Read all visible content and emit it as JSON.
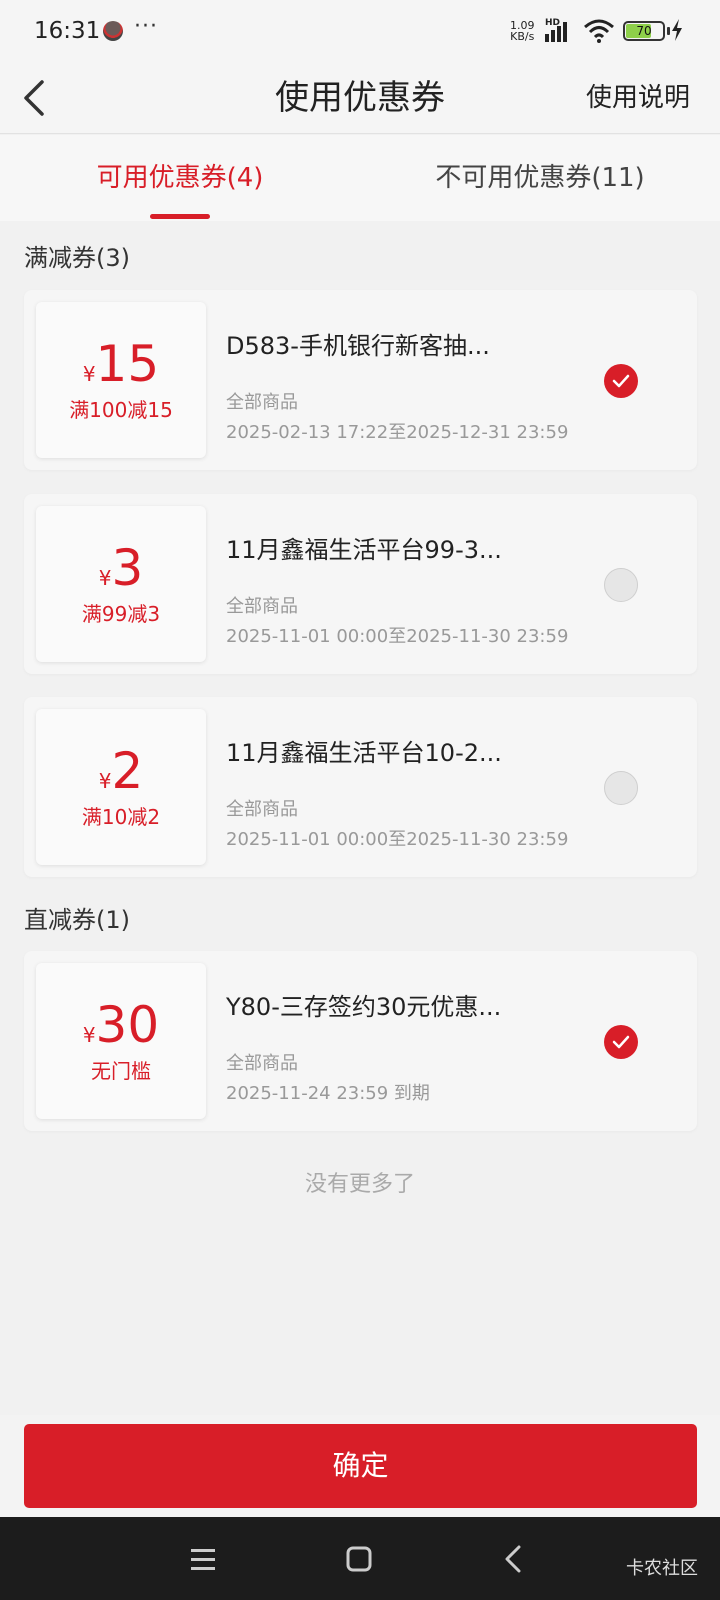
{
  "status_bar": {
    "time": "16:31",
    "more": "···",
    "net_speed_value": "1.09",
    "net_speed_unit": "KB/s",
    "network_badge": "HD",
    "battery": "70"
  },
  "nav": {
    "title": "使用优惠券",
    "help": "使用说明"
  },
  "tabs": [
    {
      "label": "可用优惠券(4)",
      "active": true
    },
    {
      "label": "不可用优惠券(11)",
      "active": false
    }
  ],
  "sections": [
    {
      "title": "满减券(3)"
    },
    {
      "title": "直减券(1)"
    }
  ],
  "coupons": [
    {
      "currency": "¥",
      "amount": "15",
      "condition": "满100减15",
      "name": "D583-手机银行新客抽...",
      "scope": "全部商品",
      "validity": "2025-02-13 17:22至2025-12-31 23:59",
      "selected": true
    },
    {
      "currency": "¥",
      "amount": "3",
      "condition": "满99减3",
      "name": "11月鑫福生活平台99-3...",
      "scope": "全部商品",
      "validity": "2025-11-01 00:00至2025-11-30 23:59",
      "selected": false
    },
    {
      "currency": "¥",
      "amount": "2",
      "condition": "满10减2",
      "name": "11月鑫福生活平台10-2...",
      "scope": "全部商品",
      "validity": "2025-11-01 00:00至2025-11-30 23:59",
      "selected": false
    },
    {
      "currency": "¥",
      "amount": "30",
      "condition": "无门槛",
      "name": "Y80-三存签约30元优惠...",
      "scope": "全部商品",
      "validity": "2025-11-24 23:59 到期",
      "selected": true
    }
  ],
  "footer_note": "没有更多了",
  "confirm_label": "确定",
  "watermark": "卡农社区",
  "colors": {
    "accent": "#d81e28",
    "background": "#f1f1f1"
  }
}
